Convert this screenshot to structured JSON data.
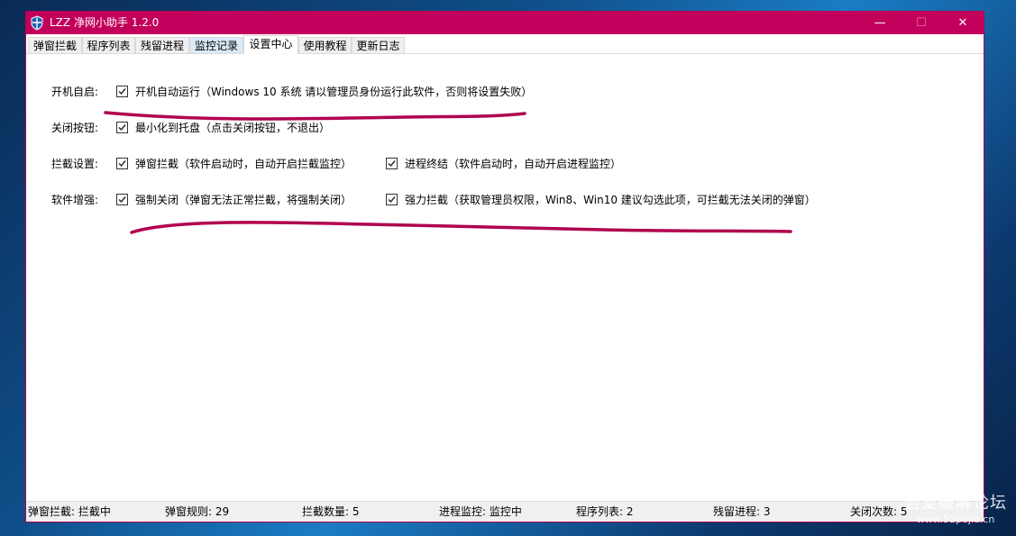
{
  "window": {
    "title": "LZZ 净网小助手 1.2.0",
    "controls": {
      "minimize": "—",
      "maximize": "☐",
      "close": "✕"
    }
  },
  "tabs": [
    {
      "label": "弹窗拦截"
    },
    {
      "label": "程序列表"
    },
    {
      "label": "残留进程"
    },
    {
      "label": "监控记录"
    },
    {
      "label": "设置中心"
    },
    {
      "label": "使用教程"
    },
    {
      "label": "更新日志"
    }
  ],
  "active_tab": "设置中心",
  "settings": {
    "startup": {
      "label": "开机自启:",
      "options": [
        {
          "text": "开机自动运行（Windows 10 系统 请以管理员身份运行此软件，否则将设置失败）",
          "checked": true
        }
      ]
    },
    "close_button": {
      "label": "关闭按钮:",
      "options": [
        {
          "text": "最小化到托盘（点击关闭按钮，不退出）",
          "checked": true
        }
      ]
    },
    "intercept": {
      "label": "拦截设置:",
      "options": [
        {
          "text": "弹窗拦截（软件启动时，自动开启拦截监控）",
          "checked": true
        },
        {
          "text": "进程终结（软件启动时，自动开启进程监控）",
          "checked": true
        }
      ]
    },
    "enhance": {
      "label": "软件增强:",
      "options": [
        {
          "text": "强制关闭（弹窗无法正常拦截，将强制关闭）",
          "checked": true
        },
        {
          "text": "强力拦截（获取管理员权限，Win8、Win10 建议勾选此项，可拦截无法关闭的弹窗）",
          "checked": true
        }
      ]
    }
  },
  "statusbar": [
    "弹窗拦截: 拦截中",
    "弹窗规则: 29",
    "拦截数量: 5",
    "进程监控: 监控中",
    "程序列表: 2",
    "残留进程: 3",
    "关闭次数: 5"
  ],
  "watermark": {
    "main": "吾爱破解论坛",
    "sub": "www.52pojie.cn"
  },
  "colors": {
    "titlebar": "#c2005c",
    "annotation": "#b0004f",
    "tab_highlight": "#d9e9f8"
  },
  "icons": {
    "app": "shield-icon",
    "checkbox": "check-icon"
  }
}
